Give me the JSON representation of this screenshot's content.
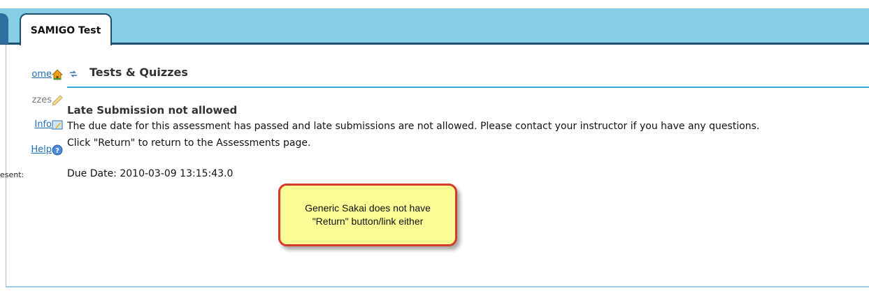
{
  "tabbar": {
    "site_tab": "SAMIGO Test"
  },
  "tool_menu": {
    "items": [
      {
        "label": "ome",
        "icon": "home-icon",
        "active": true
      },
      {
        "label": "zzes",
        "icon": "pencil-icon",
        "active": false
      },
      {
        "label": "Info",
        "icon": "info-icon",
        "active": true
      },
      {
        "label": "Help",
        "icon": "help-icon",
        "active": true
      }
    ],
    "presence_label": "esent:"
  },
  "page": {
    "title": "Tests & Quizzes",
    "message_heading": "Late Submission not allowed",
    "message_line1": "The due date for this assessment has passed and late submissions are not allowed. Please contact your instructor if you have any questions.",
    "message_line2": "Click \"Return\" to return to the Assessments page.",
    "due_date": "Due Date: 2010-03-09 13:15:43.0"
  },
  "callout": {
    "text": "Generic Sakai does not have \"Return\" button/link either",
    "border_color": "#d63a2a",
    "fill_color": "#fdfd96"
  },
  "colors": {
    "tabbar": "#86cee5",
    "tabbar_border": "#1c4e6e",
    "link": "#1f6fb6",
    "title_rule": "#33a9d6"
  }
}
